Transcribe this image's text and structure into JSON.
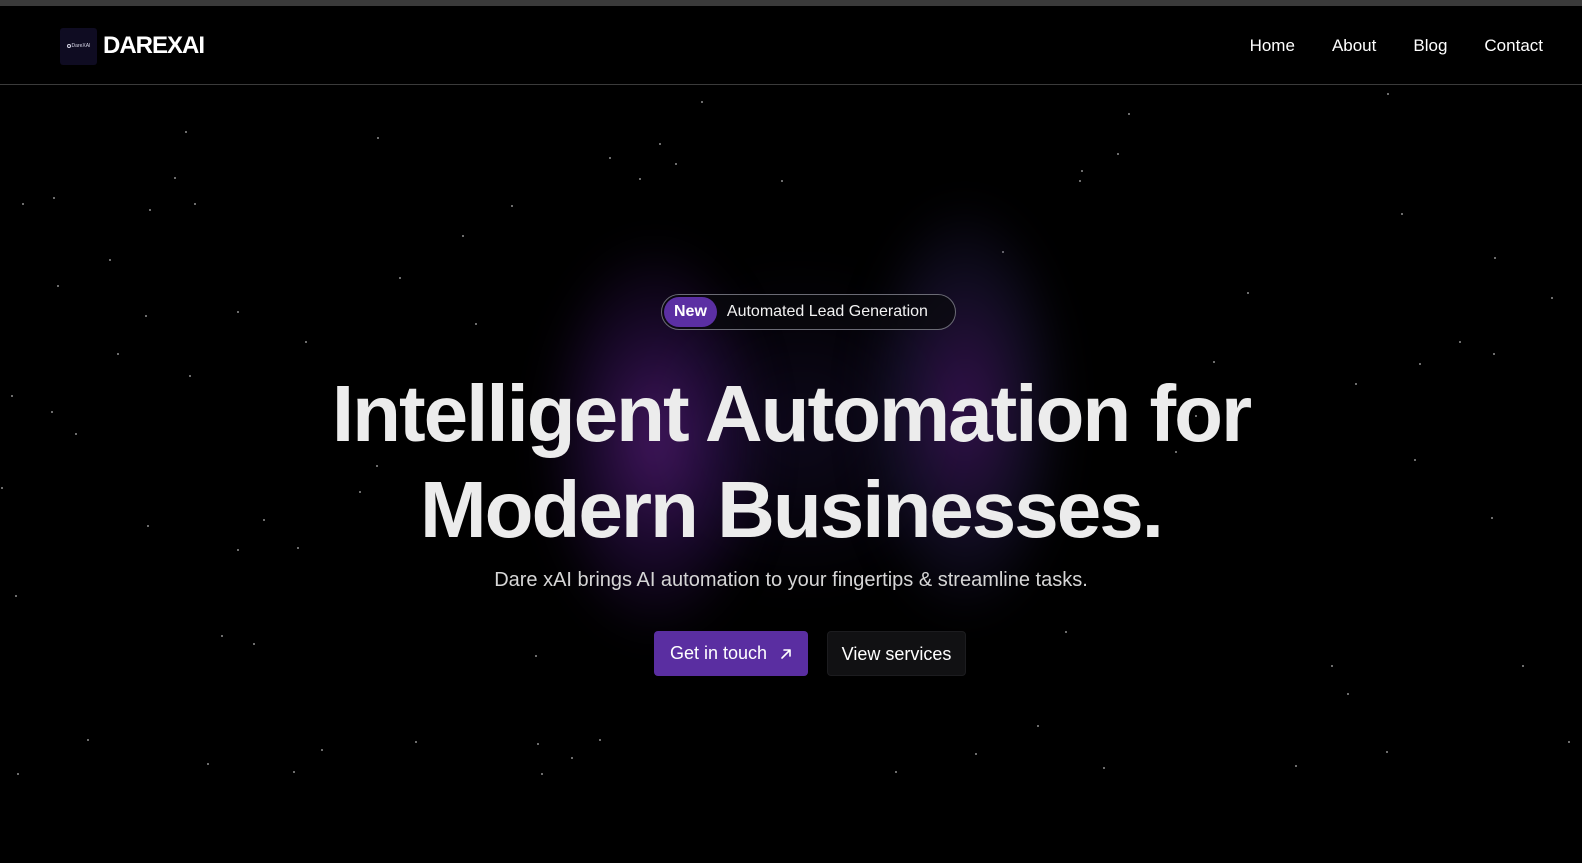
{
  "brand": {
    "logo_text": "DareXAI",
    "name": "DAREXAI"
  },
  "nav": {
    "items": [
      {
        "label": "Home"
      },
      {
        "label": "About"
      },
      {
        "label": "Blog"
      },
      {
        "label": "Contact"
      }
    ]
  },
  "hero": {
    "badge_tag": "New",
    "badge_text": "Automated Lead Generation",
    "headline_line1": "Intelligent Automation for",
    "headline_line2": "Modern Businesses.",
    "subheadline": "Dare xAI brings AI automation to your fingertips & streamline tasks.",
    "primary_cta": "Get in touch",
    "primary_cta_icon": "arrow-up-right-icon",
    "secondary_cta": "View services"
  },
  "colors": {
    "accent": "#5a2ea1",
    "background": "#000000",
    "headline": "#ececec",
    "nav_border": "#3b3b3b"
  }
}
